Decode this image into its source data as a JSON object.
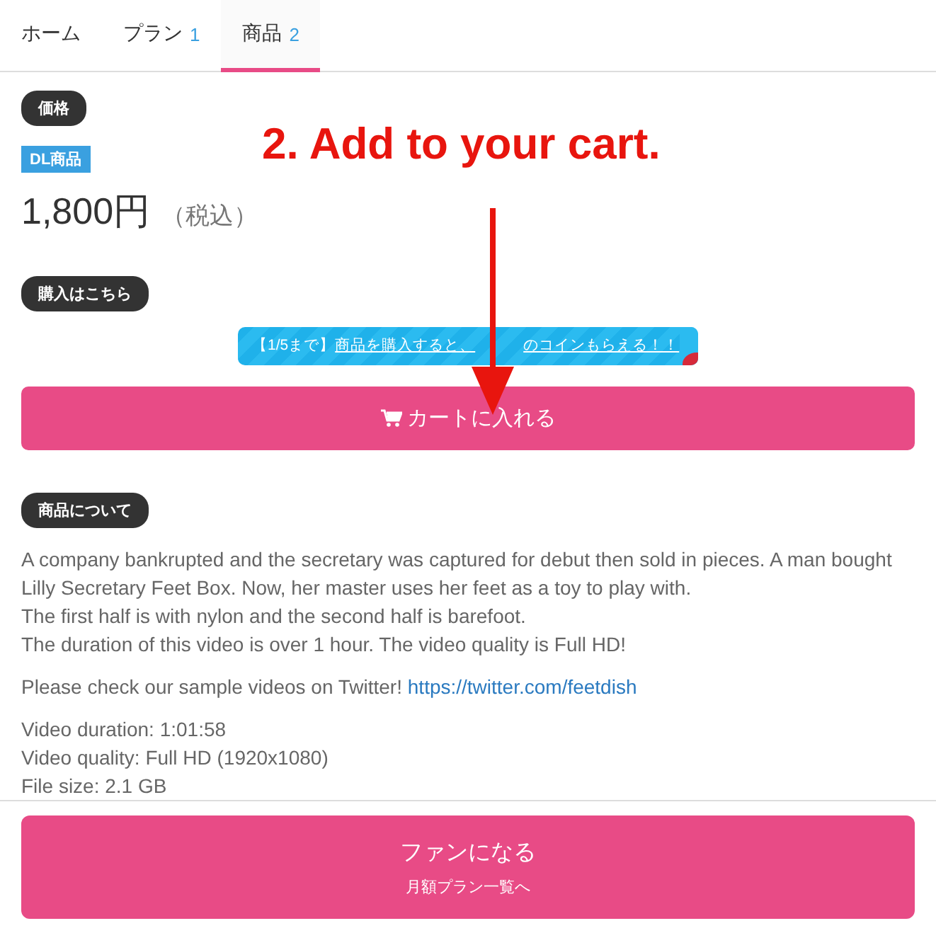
{
  "tabs": [
    {
      "label": "ホーム",
      "selected": false
    },
    {
      "label": "プラン",
      "count": "1",
      "selected": false
    },
    {
      "label": "商品",
      "count": "2",
      "selected": true
    }
  ],
  "annotation": {
    "text": "2. Add to your cart."
  },
  "price_section": {
    "badge": "価格",
    "tag": "DL商品",
    "price": "1,800円",
    "tax": "（税込）"
  },
  "purchase_section": {
    "badge": "購入はこちら",
    "banner": {
      "prefix": "【1/5まで】",
      "link_start": "商品を購入すると、",
      "link_end": "のコインもらえる！！"
    },
    "cart_button": "カートに入れる"
  },
  "about_section": {
    "badge": "商品について",
    "paragraphs": [
      "A company bankrupted and the secretary was captured for debut then sold in pieces. A man bought Lilly Secretary Feet Box. Now, her master uses her feet as a toy to play with.",
      "The first half is with nylon and the second half is barefoot.",
      "The duration of this video is over 1 hour. The video quality is Full HD!"
    ],
    "twitter": {
      "text": "Please check our sample videos on Twitter!",
      "link": "https://twitter.com/feetdish"
    },
    "specs": [
      "Video duration: 1:01:58",
      "Video quality: Full HD (1920x1080)",
      "File size: 2.1 GB"
    ]
  },
  "footer_button": {
    "title": "ファンになる",
    "subtitle": "月額プラン一覧へ"
  }
}
